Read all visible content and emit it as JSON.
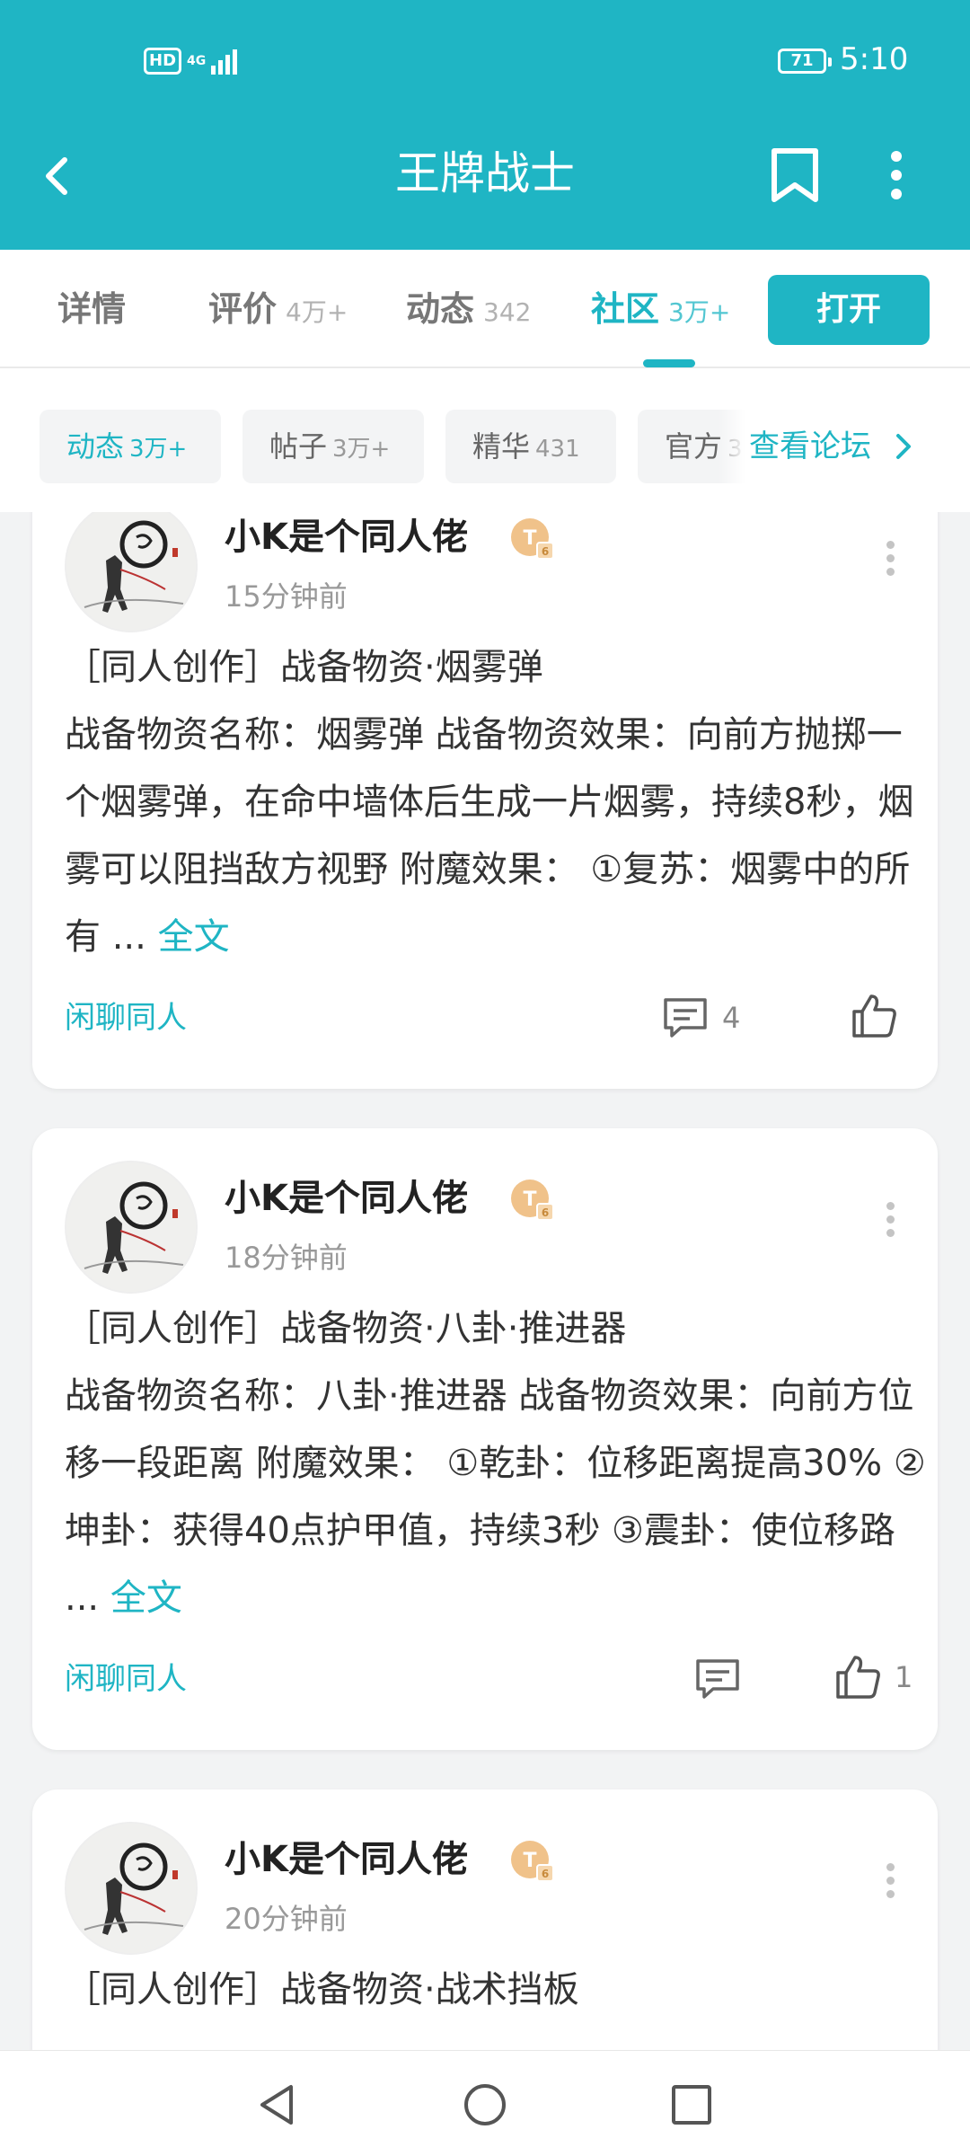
{
  "status_bar": {
    "hd": "HD",
    "network": "4G",
    "battery": "71",
    "time": "5:10"
  },
  "header": {
    "title": "王牌战士"
  },
  "tabs": [
    {
      "label": "详情",
      "count": ""
    },
    {
      "label": "评价",
      "count": "4万+"
    },
    {
      "label": "动态",
      "count": "342"
    },
    {
      "label": "社区",
      "count": "3万+"
    }
  ],
  "open_button": "打开",
  "chips": [
    {
      "label": "动态",
      "count": "3万+"
    },
    {
      "label": "帖子",
      "count": "3万+"
    },
    {
      "label": "精华",
      "count": "431"
    },
    {
      "label": "官方",
      "count": "3"
    }
  ],
  "forum_link": "查看论坛",
  "posts": [
    {
      "author": "小K是个同人佬",
      "time": "15分钟前",
      "title": "［同人创作］战备物资·烟雾弹",
      "body": "战备物资名称：烟雾弹 战备物资效果：向前方抛掷一个烟雾弹，在命中墙体后生成一片烟雾，持续8秒，烟雾可以阻挡敌方视野 附魔效果： ①复苏：烟雾中的所有 ...",
      "more": "全文",
      "topic": "闲聊同人",
      "comments": "4",
      "likes": ""
    },
    {
      "author": "小K是个同人佬",
      "time": "18分钟前",
      "title": "［同人创作］战备物资·八卦·推进器",
      "body": "战备物资名称：八卦·推进器 战备物资效果：向前方位移一段距离 附魔效果： ①乾卦：位移距离提高30% ②坤卦：获得40点护甲值，持续3秒 ③震卦：使位移路 ...",
      "more": "全文",
      "topic": "闲聊同人",
      "comments": "",
      "likes": "1"
    },
    {
      "author": "小K是个同人佬",
      "time": "20分钟前",
      "title": "［同人创作］战备物资·战术挡板"
    }
  ]
}
